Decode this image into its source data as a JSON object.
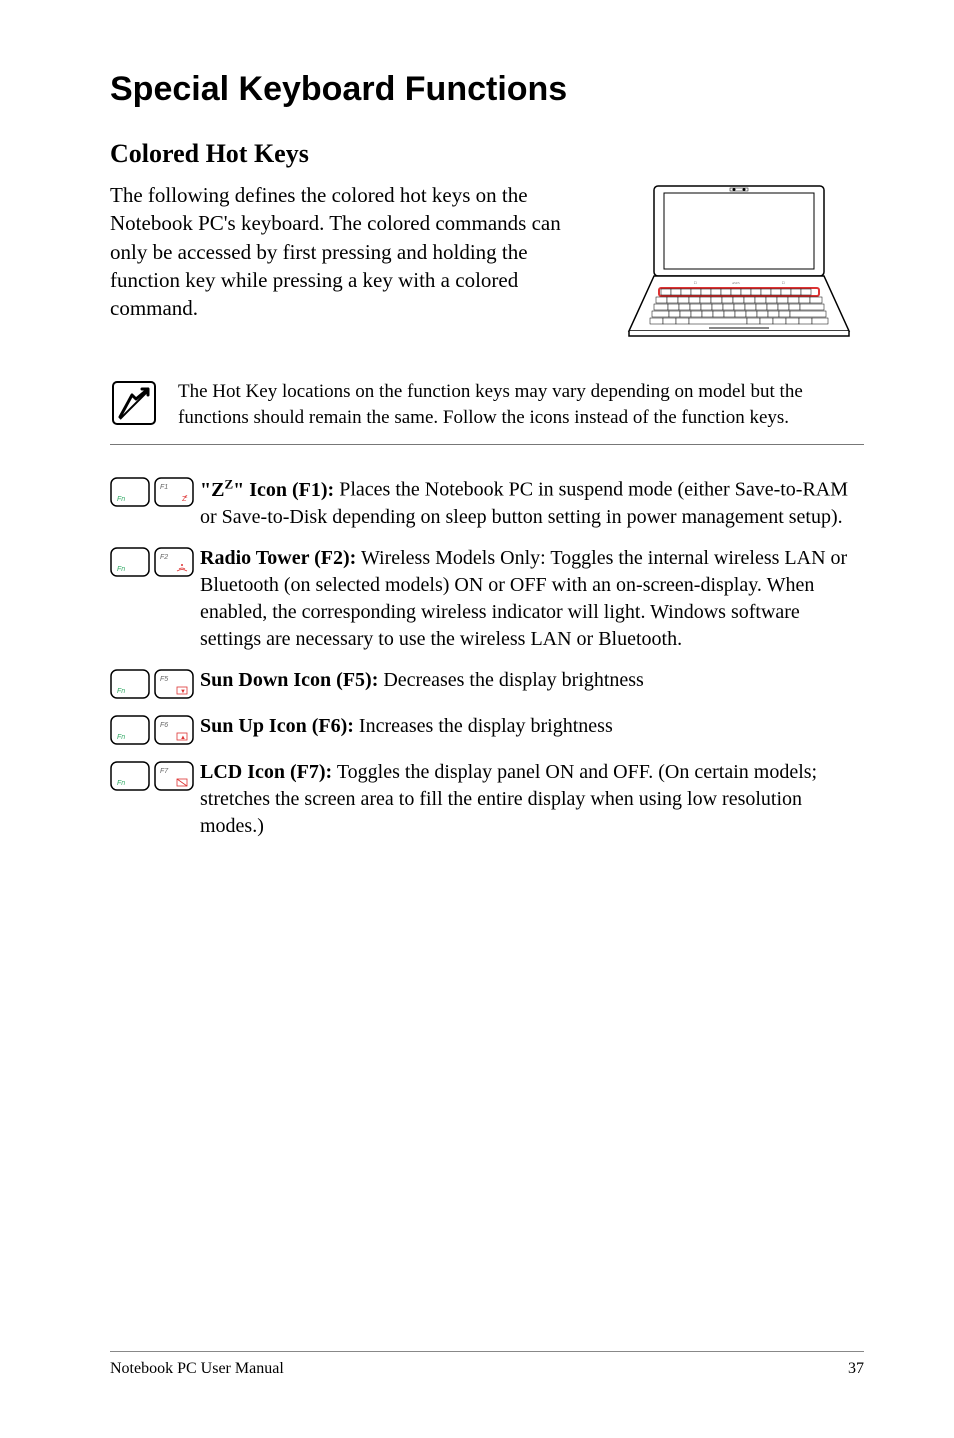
{
  "page_title": "Special Keyboard Functions",
  "section_title": "Colored Hot Keys",
  "intro": "The following defines the colored hot keys on the Notebook PC's keyboard. The colored commands can only be accessed by first pressing and holding the function key while pressing a key with a colored command.",
  "note": "The Hot Key locations on the function keys may vary depending on model but the functions should remain the same. Follow the icons instead of the function keys.",
  "hotkeys": [
    {
      "fn_label": "Fn",
      "key_label": "F1",
      "title_html": "\"Z<sup>Z</sup>\" Icon (F1):",
      "desc": " Places the Notebook PC in suspend mode (either Save-to-RAM or Save-to-Disk depending on sleep button setting in power management setup)."
    },
    {
      "fn_label": "Fn",
      "key_label": "F2",
      "title_html": "Radio Tower (F2):",
      "desc": " Wireless Models Only: Toggles the internal wireless LAN or Bluetooth (on selected models) ON or OFF with an on-screen-display. When enabled, the corresponding wireless indicator will light. Windows software settings are necessary to use the wireless LAN or Bluetooth."
    },
    {
      "fn_label": "Fn",
      "key_label": "F5",
      "title_html": "Sun Down Icon (F5):",
      "desc": " Decreases the display brightness"
    },
    {
      "fn_label": "Fn",
      "key_label": "F6",
      "title_html": "Sun Up Icon (F6):",
      "desc": " Increases the display brightness"
    },
    {
      "fn_label": "Fn",
      "key_label": "F7",
      "title_html": "LCD Icon (F7):",
      "desc": " Toggles the display panel ON and OFF. (On certain models; stretches the screen area to fill the entire display when using low resolution modes.)"
    }
  ],
  "footer_left": "Notebook PC User Manual",
  "footer_right": "37"
}
